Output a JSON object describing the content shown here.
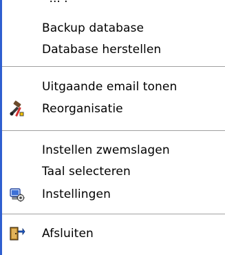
{
  "menu": {
    "partial_top_text": "- ... .-",
    "items": [
      {
        "label": "Backup database",
        "icon": null
      },
      {
        "label": "Database herstellen",
        "icon": null
      },
      {
        "label": "Uitgaande email tonen",
        "icon": null
      },
      {
        "label": "Reorganisatie",
        "icon": "tools-icon"
      },
      {
        "label": "Instellen zwemslagen",
        "icon": null
      },
      {
        "label": "Taal selecteren",
        "icon": null
      },
      {
        "label": "Instellingen",
        "icon": "settings-icon"
      },
      {
        "label": "Afsluiten",
        "icon": "exit-door-icon"
      }
    ],
    "colors": {
      "left_edge": "#2f5fd0",
      "separator": "#a0a0a0"
    }
  }
}
